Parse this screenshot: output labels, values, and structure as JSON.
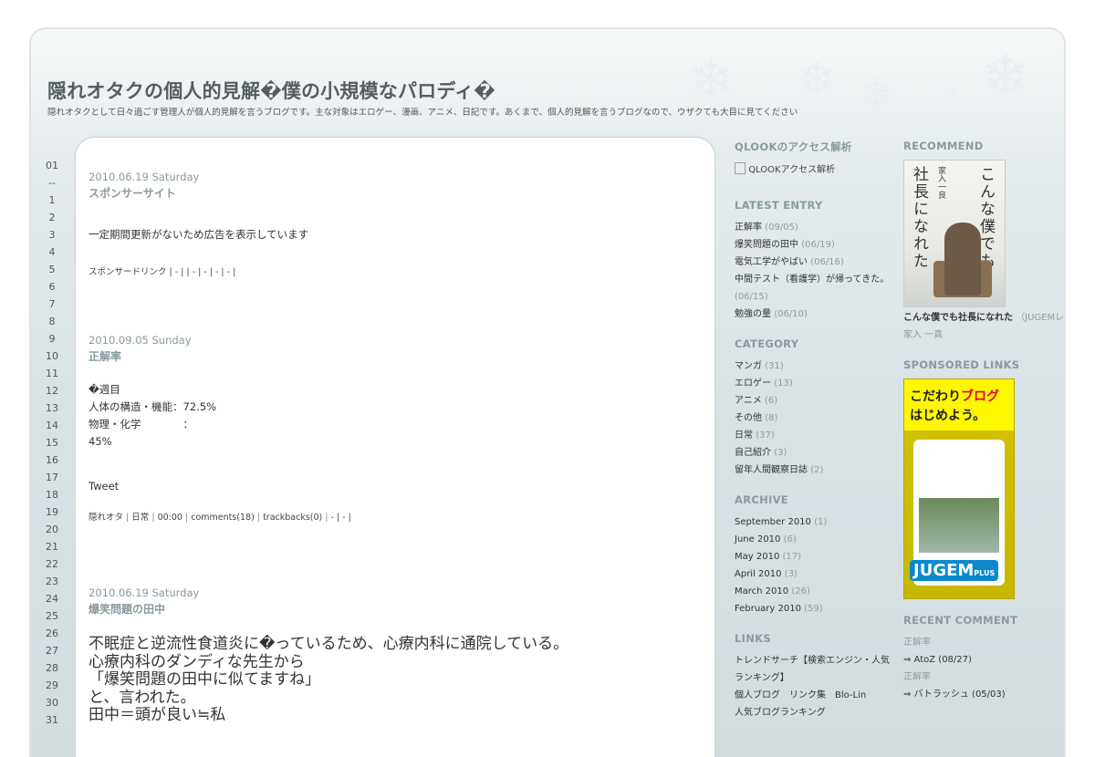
{
  "header": {
    "title": "隠れオタクの個人的見解�僕の小規模なパロディ�",
    "description": "隠れオタクとして日々過ごす管理人が個人的見解を言うブログです。主な対象はエロゲー、漫画、アニメ、日記です。あくまで、個人的見解を言うブログなので、ウザクても大目に見てください"
  },
  "calendar": {
    "month": "01",
    "separator": "--",
    "days": [
      "1",
      "2",
      "3",
      "4",
      "5",
      "6",
      "7",
      "8",
      "9",
      "10",
      "11",
      "12",
      "13",
      "14",
      "15",
      "16",
      "17",
      "18",
      "19",
      "20",
      "21",
      "22",
      "23",
      "24",
      "25",
      "26",
      "27",
      "28",
      "29",
      "30",
      "31"
    ]
  },
  "entries": [
    {
      "date": "2010.06.19 Saturday",
      "title": "スポンサーサイト",
      "body": "一定期間更新がないため広告を表示しています",
      "meta": "スポンサードリンク | - | | - | - | - | - |"
    },
    {
      "date": "2010.09.05 Sunday",
      "title": "正解率",
      "lines": [
        "�週目",
        "人体の構造・機能：72.5%",
        "物理・化学　　　　：",
        "45%"
      ],
      "tweet": "Tweet",
      "meta_author": "隠れオタ",
      "meta_category": "日常",
      "meta_time": "00:00",
      "meta_comments": "comments(18)",
      "meta_trackbacks": "trackbacks(0)",
      "meta_tail": "- | - |"
    },
    {
      "date": "2010.06.19 Saturday",
      "title": "爆笑問題の田中",
      "lines": [
        "不眠症と逆流性食道炎に�っているため、心療内科に通院している。",
        "心療内科のダンディな先生から",
        "「爆笑問題の田中に似てますね」",
        "と、言われた。",
        "田中＝頭が良い≒私"
      ]
    }
  ],
  "sidebar": {
    "qlook_title": "QLOOKのアクセス解析",
    "qlook_alt": "QLOOKアクセス解析",
    "latest_title": "LATEST ENTRY",
    "latest": [
      {
        "label": "正解率",
        "count": "(09/05)"
      },
      {
        "label": "爆笑問題の田中",
        "count": "(06/19)"
      },
      {
        "label": "電気工学がやばい",
        "count": "(06/16)"
      },
      {
        "label": "中間テスト（看護学）が帰ってきた。",
        "count": ""
      },
      {
        "label": "",
        "count": "(06/15)"
      },
      {
        "label": "勉強の量",
        "count": "(06/10)"
      }
    ],
    "category_title": "CATEGORY",
    "categories": [
      {
        "label": "マンガ",
        "count": "(31)"
      },
      {
        "label": "エロゲー",
        "count": "(13)"
      },
      {
        "label": "アニメ",
        "count": "(6)"
      },
      {
        "label": "その他",
        "count": "(8)"
      },
      {
        "label": "日常",
        "count": "(37)"
      },
      {
        "label": "自己紹介",
        "count": "(3)"
      },
      {
        "label": "留年人間観察日誌",
        "count": "(2)"
      }
    ],
    "archive_title": "ARCHIVE",
    "archives": [
      {
        "label": "September 2010",
        "count": "(1)"
      },
      {
        "label": "June 2010",
        "count": "(6)"
      },
      {
        "label": "May 2010",
        "count": "(17)"
      },
      {
        "label": "April 2010",
        "count": "(3)"
      },
      {
        "label": "March 2010",
        "count": "(26)"
      },
      {
        "label": "February 2010",
        "count": "(59)"
      }
    ],
    "links_title": "LINKS",
    "links": [
      "トレンドサーチ【検索エンジン・人気",
      "ランキング】",
      "個人ブログ　リンク集　Blo-Lin",
      "人気ブログランキング"
    ],
    "recommend_title": "RECOMMEND",
    "book_title_right": "こんな僕でも",
    "book_title_left": "社長になれた",
    "book_author_vertical": "家入一良",
    "book_name": "こんな僕でも社長になれた",
    "book_review": "（JUGEMレビュー »）",
    "book_author": "家入 一真",
    "sponsored_title": "SPONSORED LINKS",
    "ad_line1a": "こだわり",
    "ad_line1b": "ブログ",
    "ad_line2": "はじめよう。",
    "ad_brand": "JUGEM",
    "ad_plus": "PLUS",
    "recent_title": "RECENT COMMENT",
    "recent": [
      {
        "entry": "正解率",
        "by": "⇒ AtoZ (08/27)"
      },
      {
        "entry": "正解率",
        "by": "⇒ バトラッシュ (05/03)"
      }
    ]
  }
}
